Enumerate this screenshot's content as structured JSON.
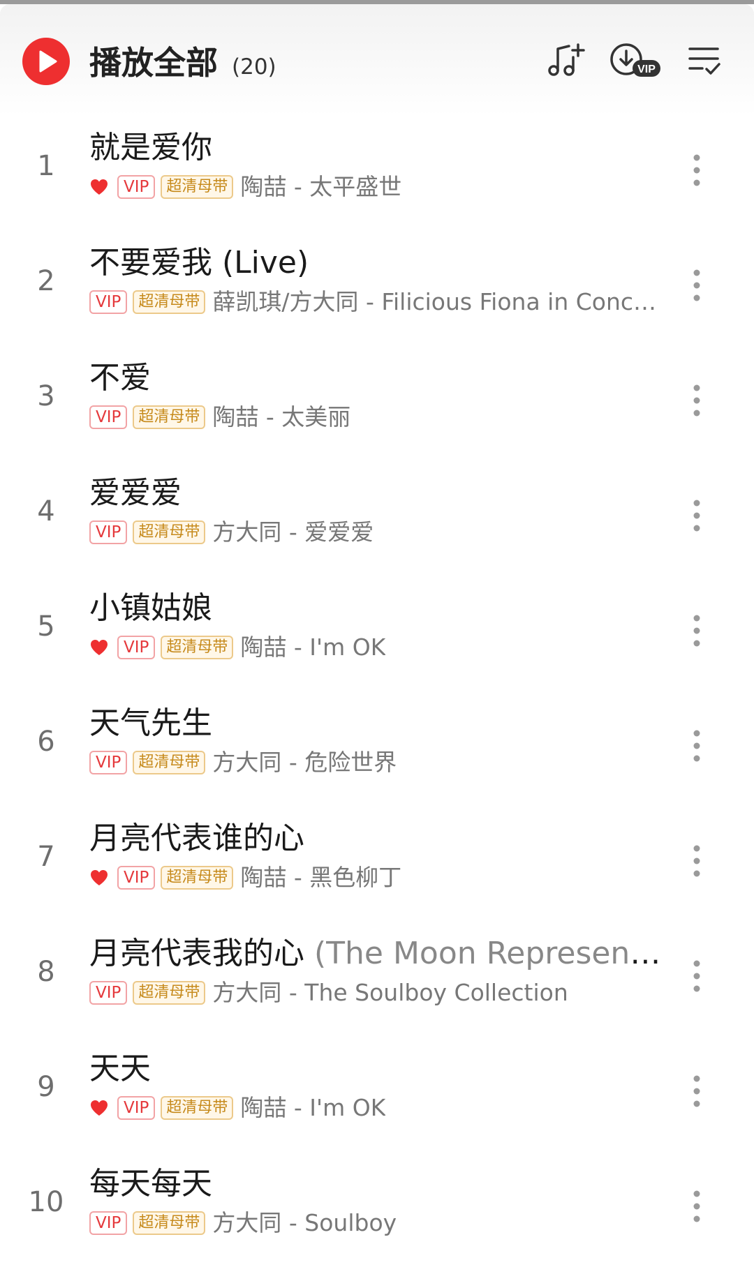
{
  "header": {
    "title": "播放全部",
    "count": "(20)",
    "icons": [
      "play-icon",
      "add-music-icon",
      "download-vip-icon",
      "multi-select-icon"
    ],
    "download_badge": "VIP"
  },
  "colors": {
    "accent": "#ee2f30",
    "vip_border": "#f2a3a5",
    "hq_gold": "#c68a1b"
  },
  "badges": {
    "vip": "VIP",
    "hq": "超清母带"
  },
  "songs": [
    {
      "num": "1",
      "title": "就是爱你",
      "liked": true,
      "artist": "陶喆 - 太平盛世"
    },
    {
      "num": "2",
      "title": "不要爱我 (Live)",
      "liked": false,
      "artist": "薛凯琪/方大同 - Filicious Fiona in Concer..."
    },
    {
      "num": "3",
      "title": "不爱",
      "liked": false,
      "artist": "陶喆 - 太美丽"
    },
    {
      "num": "4",
      "title": "爱爱爱",
      "liked": false,
      "artist": "方大同 - 爱爱爱"
    },
    {
      "num": "5",
      "title": "小镇姑娘",
      "liked": true,
      "artist": "陶喆 - I'm OK"
    },
    {
      "num": "6",
      "title": "天气先生",
      "liked": false,
      "artist": "方大同 - 危险世界"
    },
    {
      "num": "7",
      "title": "月亮代表谁的心",
      "liked": true,
      "artist": "陶喆 - 黑色柳丁"
    },
    {
      "num": "8",
      "title": "月亮代表我的心",
      "title_extra": " (The Moon Represent...",
      "liked": false,
      "artist": "方大同 - The Soulboy Collection"
    },
    {
      "num": "9",
      "title": "天天",
      "liked": true,
      "artist": "陶喆 - I'm OK"
    },
    {
      "num": "10",
      "title": "每天每天",
      "liked": false,
      "artist": "方大同 - Soulboy"
    }
  ]
}
